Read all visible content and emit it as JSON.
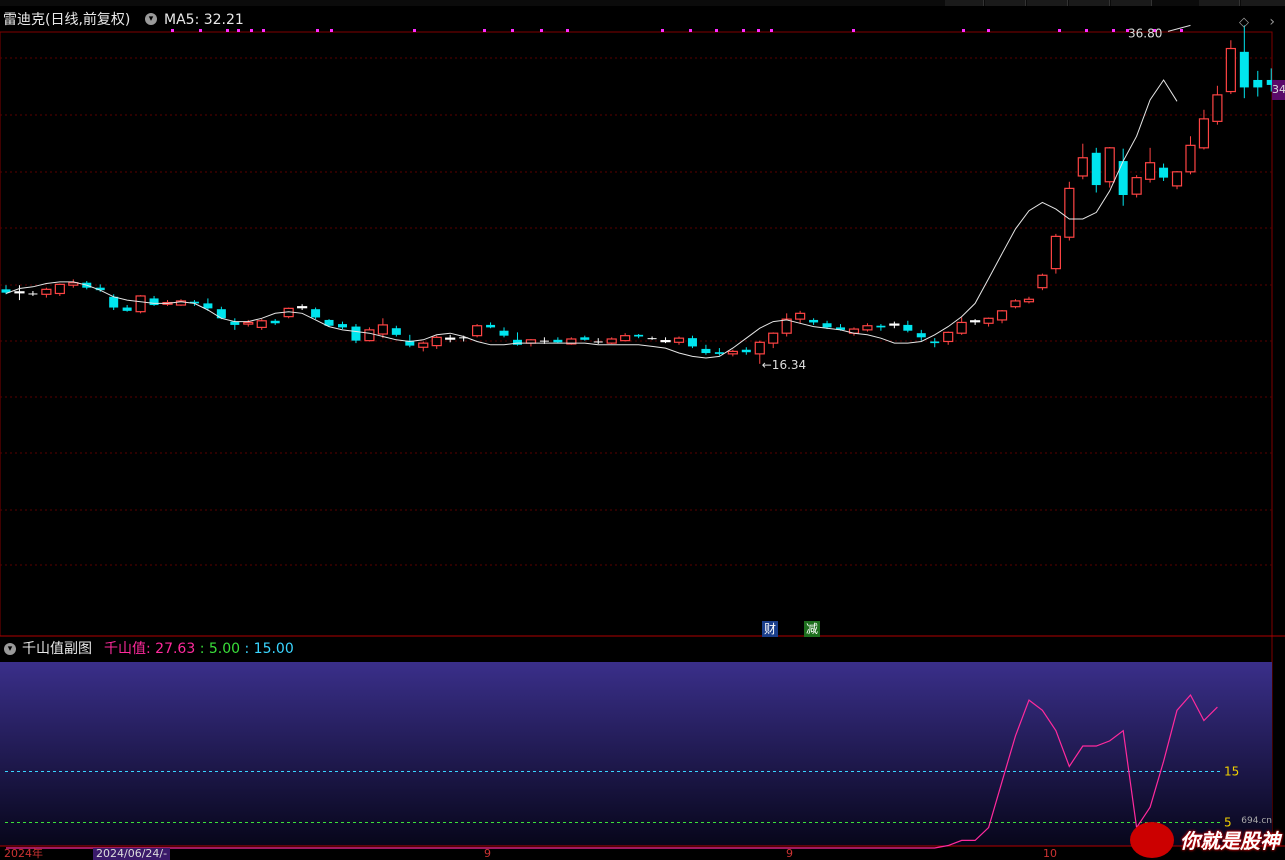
{
  "header": {
    "stock_name": "雷迪克(日线,前复权)",
    "ma_label": "MA5: 32.21",
    "price_tag": "34"
  },
  "annotations": {
    "high": "36.80",
    "low": "16.34",
    "event_cai": "财",
    "event_jian": "减"
  },
  "sub_indicator": {
    "name": "千山值副图",
    "label": "千山值",
    "value": ": 27.63",
    "level_low": ": 5.00",
    "level_high": ": 15.00",
    "ref_high_label": "15",
    "ref_low_label": "5"
  },
  "x_axis": {
    "date_tag": "2024/06/24/-",
    "labels": [
      "2024年",
      "9",
      "9",
      "10"
    ]
  },
  "watermark": {
    "text": "你就是股神",
    "site": "694.cn"
  },
  "colors": {
    "up": "#ff4444",
    "down": "#00e5ee",
    "ma": "#e6e6e6",
    "indicator": "#ff2a9d",
    "ref15": "#3ad5ff",
    "ref5": "#3adf3a"
  },
  "chart_data": {
    "type": "candlestick",
    "series": [
      {
        "name": "MA5",
        "values": [
          20.6,
          20.9,
          21.0,
          21.2,
          21.3,
          21.3,
          21.1,
          20.8,
          20.4,
          20.2,
          20.1,
          20.0,
          20.0,
          20.1,
          20.0,
          19.6,
          19.1,
          18.9,
          18.9,
          19.1,
          19.4,
          19.5,
          19.4,
          19.0,
          18.6,
          18.4,
          18.3,
          18.2,
          18.0,
          17.8,
          17.7,
          17.8,
          18.1,
          18.2,
          18.0,
          17.7,
          17.5,
          17.5,
          17.6,
          17.6,
          17.6,
          17.6,
          17.6,
          17.6,
          17.5,
          17.5,
          17.5,
          17.5,
          17.4,
          17.3,
          17.0,
          16.8,
          16.7,
          16.8,
          17.3,
          17.9,
          18.5,
          18.9,
          19.0,
          18.8,
          18.6,
          18.5,
          18.4,
          18.2,
          18.1,
          17.9,
          17.6,
          17.6,
          17.7,
          18.1,
          18.6,
          19.2,
          20.0,
          21.5,
          23.0,
          24.5,
          25.6,
          26.1,
          25.7,
          25.1,
          25.1,
          25.5,
          26.8,
          28.6,
          30.1,
          32.3,
          33.5,
          32.21
        ]
      }
    ],
    "ohlc": [
      [
        20.85,
        21.1,
        20.55,
        20.65
      ],
      [
        20.65,
        21.1,
        20.2,
        20.7
      ],
      [
        20.6,
        20.75,
        20.45,
        20.55
      ],
      [
        20.55,
        20.95,
        20.35,
        20.85
      ],
      [
        20.6,
        21.2,
        20.45,
        21.15
      ],
      [
        21.1,
        21.45,
        20.95,
        21.25
      ],
      [
        21.25,
        21.35,
        20.85,
        20.95
      ],
      [
        20.95,
        21.15,
        20.7,
        20.8
      ],
      [
        20.4,
        20.55,
        19.6,
        19.75
      ],
      [
        19.75,
        19.9,
        19.5,
        19.55
      ],
      [
        19.5,
        20.5,
        19.4,
        20.45
      ],
      [
        20.3,
        20.45,
        19.85,
        19.9
      ],
      [
        19.95,
        20.2,
        19.85,
        20.05
      ],
      [
        19.9,
        20.25,
        19.85,
        20.15
      ],
      [
        20.1,
        20.2,
        19.85,
        20.0
      ],
      [
        20.0,
        20.3,
        19.55,
        19.7
      ],
      [
        19.65,
        19.8,
        19.05,
        19.1
      ],
      [
        18.9,
        19.1,
        18.4,
        18.7
      ],
      [
        18.75,
        19.0,
        18.6,
        18.85
      ],
      [
        18.55,
        19.05,
        18.4,
        18.95
      ],
      [
        18.95,
        19.05,
        18.7,
        18.8
      ],
      [
        19.2,
        19.75,
        19.1,
        19.7
      ],
      [
        19.75,
        19.95,
        19.6,
        19.8
      ],
      [
        19.65,
        19.75,
        19.05,
        19.15
      ],
      [
        19.0,
        19.05,
        18.6,
        18.65
      ],
      [
        18.75,
        18.9,
        18.45,
        18.55
      ],
      [
        18.6,
        18.75,
        17.6,
        17.75
      ],
      [
        17.75,
        18.55,
        17.7,
        18.4
      ],
      [
        18.15,
        19.1,
        17.9,
        18.7
      ],
      [
        18.5,
        18.65,
        18.0,
        18.1
      ],
      [
        17.75,
        18.1,
        17.35,
        17.45
      ],
      [
        17.35,
        17.7,
        17.1,
        17.6
      ],
      [
        17.45,
        18.05,
        17.25,
        17.95
      ],
      [
        17.85,
        18.1,
        17.65,
        17.9
      ],
      [
        17.95,
        18.05,
        17.7,
        17.95
      ],
      [
        18.05,
        18.75,
        17.95,
        18.65
      ],
      [
        18.7,
        18.85,
        18.5,
        18.55
      ],
      [
        18.35,
        18.55,
        17.95,
        18.05
      ],
      [
        17.8,
        18.25,
        17.45,
        17.5
      ],
      [
        17.6,
        17.85,
        17.4,
        17.8
      ],
      [
        17.75,
        17.95,
        17.55,
        17.7
      ],
      [
        17.8,
        17.95,
        17.6,
        17.65
      ],
      [
        17.55,
        17.95,
        17.5,
        17.85
      ],
      [
        17.95,
        18.05,
        17.75,
        17.8
      ],
      [
        17.7,
        17.9,
        17.55,
        17.65
      ],
      [
        17.6,
        17.95,
        17.55,
        17.85
      ],
      [
        17.75,
        18.2,
        17.7,
        18.05
      ],
      [
        18.1,
        18.15,
        17.9,
        18.0
      ],
      [
        17.9,
        18.0,
        17.8,
        17.85
      ],
      [
        17.7,
        17.95,
        17.6,
        17.75
      ],
      [
        17.65,
        18.0,
        17.5,
        17.9
      ],
      [
        17.9,
        18.05,
        17.3,
        17.4
      ],
      [
        17.25,
        17.5,
        16.9,
        17.0
      ],
      [
        17.05,
        17.3,
        16.85,
        16.95
      ],
      [
        16.95,
        17.2,
        16.8,
        17.1
      ],
      [
        17.2,
        17.35,
        16.9,
        17.05
      ],
      [
        16.95,
        17.75,
        16.35,
        17.65
      ],
      [
        17.6,
        18.25,
        17.3,
        18.2
      ],
      [
        18.2,
        19.4,
        18.0,
        19.05
      ],
      [
        19.05,
        19.55,
        18.8,
        19.4
      ],
      [
        19.0,
        19.1,
        18.7,
        18.85
      ],
      [
        18.8,
        18.95,
        18.45,
        18.55
      ],
      [
        18.55,
        18.75,
        18.35,
        18.4
      ],
      [
        18.2,
        18.55,
        18.05,
        18.45
      ],
      [
        18.4,
        18.8,
        18.3,
        18.65
      ],
      [
        18.65,
        18.75,
        18.35,
        18.55
      ],
      [
        18.7,
        18.9,
        18.5,
        18.75
      ],
      [
        18.7,
        18.95,
        18.25,
        18.35
      ],
      [
        18.2,
        18.4,
        17.75,
        17.95
      ],
      [
        17.7,
        17.9,
        17.35,
        17.6
      ],
      [
        17.7,
        18.3,
        17.5,
        18.25
      ],
      [
        18.2,
        19.15,
        18.1,
        18.85
      ],
      [
        18.9,
        19.05,
        18.7,
        18.95
      ],
      [
        18.8,
        19.15,
        18.6,
        19.1
      ],
      [
        19.0,
        19.6,
        18.8,
        19.55
      ],
      [
        19.8,
        20.25,
        19.7,
        20.15
      ],
      [
        20.1,
        20.4,
        20.0,
        20.25
      ],
      [
        20.95,
        21.8,
        20.8,
        21.7
      ],
      [
        22.1,
        24.2,
        21.8,
        24.05
      ],
      [
        24.0,
        27.35,
        23.8,
        26.95
      ],
      [
        27.7,
        29.65,
        27.5,
        28.8
      ],
      [
        29.1,
        29.4,
        26.7,
        27.15
      ],
      [
        27.35,
        29.45,
        27.0,
        29.4
      ],
      [
        28.6,
        29.35,
        25.9,
        26.55
      ],
      [
        26.6,
        27.75,
        26.4,
        27.6
      ],
      [
        27.5,
        29.4,
        27.3,
        28.5
      ],
      [
        28.2,
        28.45,
        27.4,
        27.6
      ],
      [
        27.1,
        28.0,
        26.9,
        27.95
      ],
      [
        27.95,
        30.1,
        27.8,
        29.55
      ],
      [
        29.4,
        31.7,
        29.3,
        31.15
      ],
      [
        31.0,
        33.15,
        30.8,
        32.6
      ],
      [
        32.8,
        35.9,
        32.65,
        35.4
      ],
      [
        35.2,
        36.8,
        32.4,
        33.05
      ],
      [
        33.5,
        34.05,
        32.5,
        33.05
      ],
      [
        33.5,
        34.2,
        32.8,
        33.2
      ]
    ],
    "indicator": {
      "name": "千山值",
      "values": [
        0,
        0,
        0,
        0,
        0,
        0,
        0,
        0,
        0,
        0,
        0,
        0,
        0,
        0,
        0,
        0,
        0,
        0,
        0,
        0,
        0,
        0,
        0,
        0,
        0,
        0,
        0,
        0,
        0,
        0,
        0,
        0,
        0,
        0,
        0,
        0,
        0,
        0,
        0,
        0,
        0,
        0,
        0,
        0,
        0,
        0,
        0,
        0,
        0,
        0,
        0,
        0,
        0,
        0,
        0,
        0,
        0,
        0,
        0,
        0,
        0,
        0,
        0,
        0,
        0,
        0,
        0,
        0,
        0,
        0,
        0.5,
        1.5,
        1.5,
        4,
        13,
        22,
        29,
        27,
        23,
        16,
        20,
        20,
        21,
        23,
        4,
        8,
        17,
        27,
        30,
        25,
        27.63
      ]
    },
    "levels": [
      5,
      15
    ],
    "high": 36.8,
    "low": 16.34
  }
}
